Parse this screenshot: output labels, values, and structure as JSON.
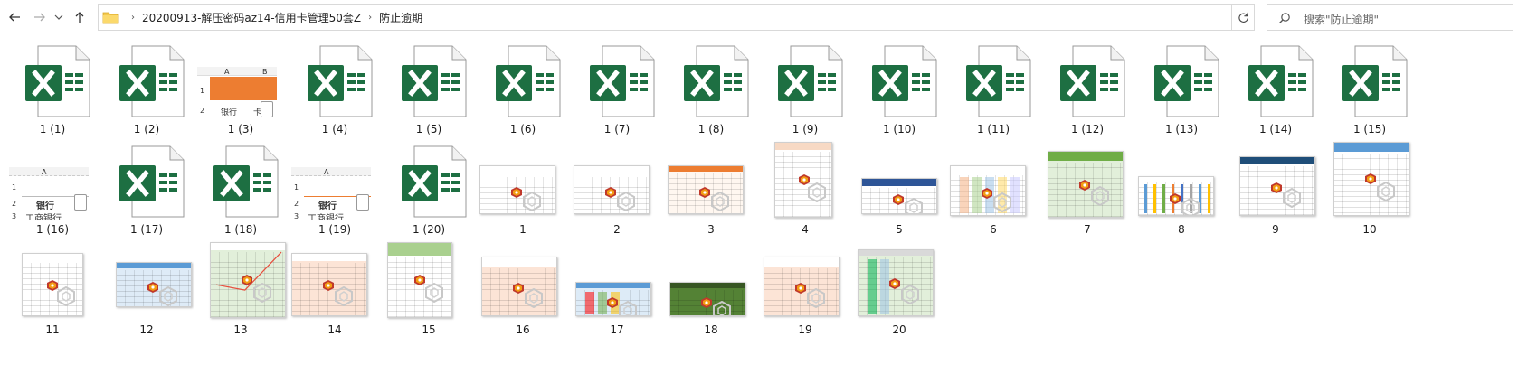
{
  "address": {
    "crumbs": [
      "20200913-解压密码az14-信用卡管理50套Z",
      "防止逾期"
    ]
  },
  "search": {
    "placeholder": "搜索\"防止逾期\""
  },
  "files": [
    {
      "name": "1 (1)",
      "kind": "excel"
    },
    {
      "name": "1 (2)",
      "kind": "excel"
    },
    {
      "name": "1 (3)",
      "kind": "sheet-orange",
      "cells": {
        "col_a": "A",
        "col_b": "B",
        "r1": "1",
        "r2": "2",
        "c1": "银行",
        "c2": "卡号"
      }
    },
    {
      "name": "1 (4)",
      "kind": "excel"
    },
    {
      "name": "1 (5)",
      "kind": "excel"
    },
    {
      "name": "1 (6)",
      "kind": "excel"
    },
    {
      "name": "1 (7)",
      "kind": "excel"
    },
    {
      "name": "1 (8)",
      "kind": "excel"
    },
    {
      "name": "1 (9)",
      "kind": "excel"
    },
    {
      "name": "1 (10)",
      "kind": "excel"
    },
    {
      "name": "1 (11)",
      "kind": "excel"
    },
    {
      "name": "1 (12)",
      "kind": "excel"
    },
    {
      "name": "1 (13)",
      "kind": "excel"
    },
    {
      "name": "1 (14)",
      "kind": "excel"
    },
    {
      "name": "1 (15)",
      "kind": "excel"
    },
    {
      "name": "1 (16)",
      "kind": "sheet-bank",
      "cells": {
        "col_a": "A",
        "r1": "1",
        "r2": "2",
        "r3": "3",
        "c1": "银行",
        "c2": "工商银行"
      }
    },
    {
      "name": "1 (17)",
      "kind": "excel"
    },
    {
      "name": "1 (18)",
      "kind": "excel"
    },
    {
      "name": "1 (19)",
      "kind": "sheet-bank2",
      "cells": {
        "col_a": "A",
        "r1": "1",
        "r2": "2",
        "r3": "3",
        "c1": "银行",
        "c2": "工商银行"
      }
    },
    {
      "name": "1 (20)",
      "kind": "excel"
    },
    {
      "name": "1",
      "kind": "thumb",
      "style": "plain"
    },
    {
      "name": "2",
      "kind": "thumb",
      "style": "plain"
    },
    {
      "name": "3",
      "kind": "thumb",
      "style": "orange-head"
    },
    {
      "name": "4",
      "kind": "thumb",
      "style": "tall"
    },
    {
      "name": "5",
      "kind": "thumb",
      "style": "blue-small"
    },
    {
      "name": "6",
      "kind": "thumb",
      "style": "colorful"
    },
    {
      "name": "7",
      "kind": "thumb",
      "style": "green-head"
    },
    {
      "name": "8",
      "kind": "thumb",
      "style": "stripes"
    },
    {
      "name": "9",
      "kind": "thumb",
      "style": "blue-calc"
    },
    {
      "name": "10",
      "kind": "thumb",
      "style": "blue-head"
    },
    {
      "name": "11",
      "kind": "thumb",
      "style": "plain-gray"
    },
    {
      "name": "12",
      "kind": "thumb",
      "style": "blue-grid"
    },
    {
      "name": "13",
      "kind": "thumb",
      "style": "green-chart"
    },
    {
      "name": "14",
      "kind": "thumb",
      "style": "peach"
    },
    {
      "name": "15",
      "kind": "thumb",
      "style": "green-top"
    },
    {
      "name": "16",
      "kind": "thumb",
      "style": "peach-tall"
    },
    {
      "name": "17",
      "kind": "thumb",
      "style": "blue-wide"
    },
    {
      "name": "18",
      "kind": "thumb",
      "style": "dark-green"
    },
    {
      "name": "19",
      "kind": "thumb",
      "style": "peach2"
    },
    {
      "name": "20",
      "kind": "thumb",
      "style": "teal-green"
    }
  ],
  "colors": {
    "excel_green": "#1d6f42",
    "accent_orange": "#ed7d31"
  }
}
